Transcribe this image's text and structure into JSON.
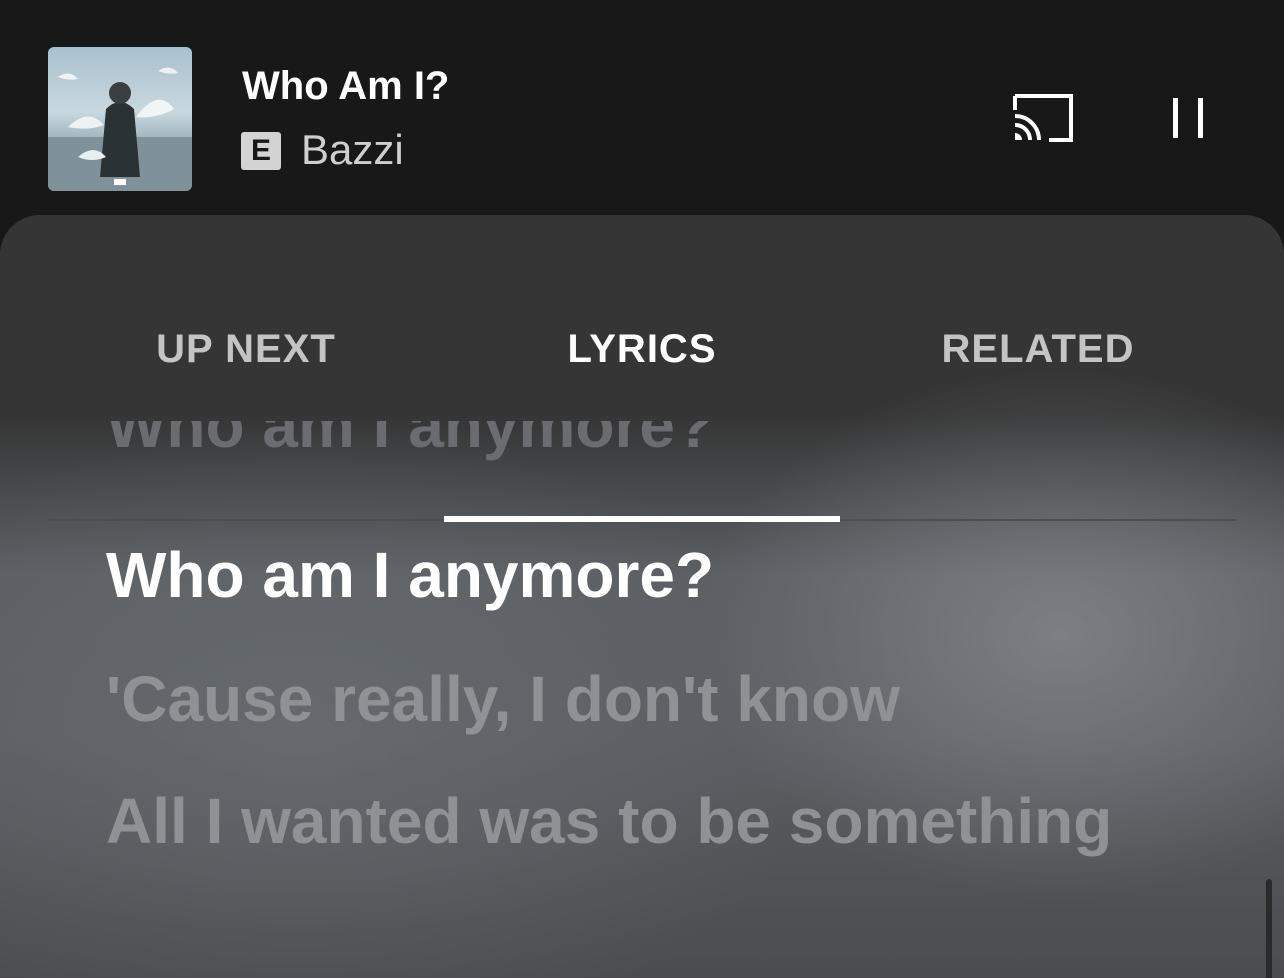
{
  "player": {
    "title": "Who Am I?",
    "explicit_badge": "E",
    "artist": "Bazzi"
  },
  "controls": {
    "cast_icon": "cast-icon",
    "pause_icon": "pause-icon"
  },
  "tabs": [
    {
      "label": "UP NEXT",
      "active": false
    },
    {
      "label": "LYRICS",
      "active": true
    },
    {
      "label": "RELATED",
      "active": false
    }
  ],
  "lyrics": {
    "previous_line": "Who am I anymore?",
    "current_line": "Who am I anymore?",
    "upcoming_lines": [
      "'Cause really, I don't know",
      "All I wanted was to be something"
    ]
  },
  "colors": {
    "background": "#181818",
    "active_text": "#ffffff",
    "inactive_tab": "#c4c4c4",
    "upcoming_lyric": "#8f9194"
  }
}
